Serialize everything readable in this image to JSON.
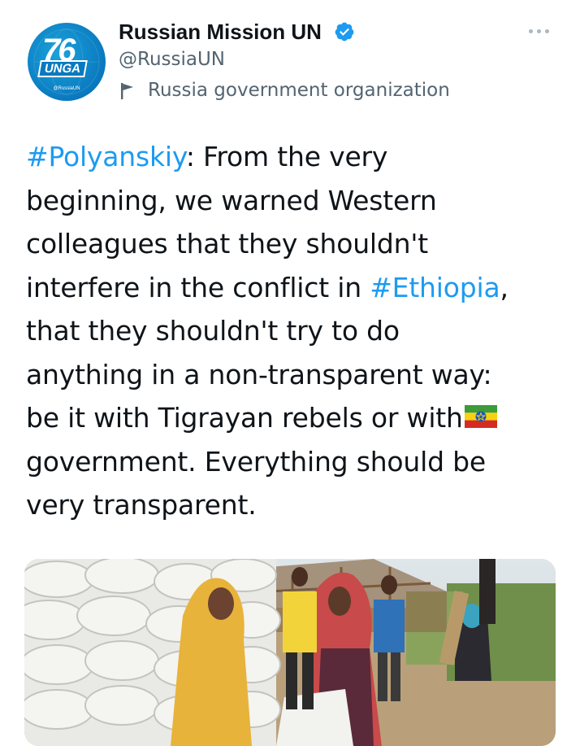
{
  "account": {
    "display_name": "Russian Mission UN",
    "handle": "@RussiaUN",
    "label": "Russia government organization",
    "avatar_number": "76",
    "avatar_tag": "UNGA",
    "avatar_handle": "@RussiaUN"
  },
  "tweet": {
    "lines": [
      {
        "hashtag": "#Polyanskiy",
        "text": ": From the very"
      },
      {
        "text": "beginning, we warned Western"
      },
      {
        "text": "colleagues that they shouldn't"
      },
      {
        "text": "interfere in the conflict in ",
        "hashtag": "#Ethiopia",
        "after": ","
      },
      {
        "text": "that they shouldn't try to do"
      },
      {
        "text": "anything in a non-transparent way:"
      },
      {
        "text": "be it with Tigrayan rebels or with",
        "emoji": "ethiopia-flag"
      },
      {
        "text": "government. Everything should be"
      },
      {
        "text": "very transparent."
      }
    ]
  },
  "colors": {
    "hashtag": "#1d9bf0",
    "verified": "#1d9bf0",
    "secondary_text": "#536471"
  },
  "icons": [
    "verified-badge-icon",
    "flag-icon",
    "more-options-icon",
    "ethiopia-flag-emoji"
  ]
}
